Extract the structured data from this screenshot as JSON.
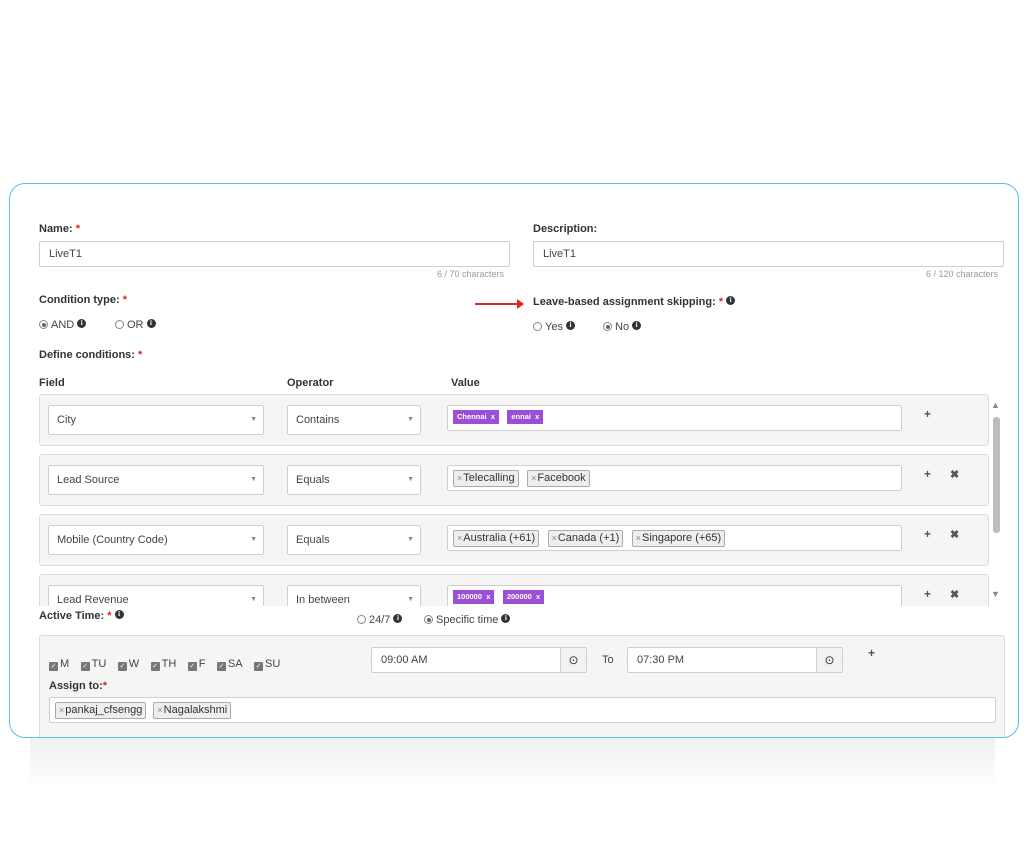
{
  "name": {
    "label": "Name:",
    "required": "*",
    "value": "LiveT1",
    "counter": "6 / 70 characters"
  },
  "description": {
    "label": "Description:",
    "value": "LiveT1",
    "counter": "6 / 120 characters"
  },
  "condition_type": {
    "label": "Condition type:",
    "required": "*",
    "options": [
      "AND",
      "OR"
    ],
    "selected": "AND"
  },
  "leave_skipping": {
    "label": "Leave-based assignment skipping:",
    "required": "*",
    "options": [
      "Yes",
      "No"
    ],
    "selected": "No"
  },
  "define_conditions": {
    "label": "Define conditions:",
    "required": "*"
  },
  "columns": {
    "field": "Field",
    "operator": "Operator",
    "value": "Value"
  },
  "conditions": [
    {
      "field": "City",
      "operator": "Contains",
      "tag_style": "purple",
      "values": [
        "Chennai",
        "ennai"
      ]
    },
    {
      "field": "Lead Source",
      "operator": "Equals",
      "tag_style": "grey",
      "values": [
        "Telecalling",
        "Facebook"
      ]
    },
    {
      "field": "Mobile (Country Code)",
      "operator": "Equals",
      "tag_style": "grey",
      "values": [
        "Australia (+61)",
        "Canada (+1)",
        "Singapore (+65)"
      ]
    },
    {
      "field": "Lead Revenue",
      "operator": "In between",
      "tag_style": "purple",
      "values": [
        "100000",
        "200000"
      ]
    }
  ],
  "active_time": {
    "label": "Active Time:",
    "required": "*",
    "options": [
      "24/7",
      "Specific time"
    ],
    "selected": "Specific time",
    "days": [
      "M",
      "TU",
      "W",
      "TH",
      "F",
      "SA",
      "SU"
    ],
    "from": "09:00 AM",
    "to_label": "To",
    "to": "07:30 PM"
  },
  "assign_to": {
    "label": "Assign to:",
    "required": "*",
    "users": [
      "pankaj_cfsengg",
      "Nagalakshmi"
    ]
  },
  "icons": {
    "info": "info-icon",
    "add": "plus-icon",
    "remove": "close-icon",
    "clock": "clock-icon",
    "tag_remove": "x-icon"
  },
  "colors": {
    "border": "#5bc0e6",
    "tag_purple": "#9b4fd6",
    "required": "#e02424",
    "annotation_arrow": "#e02424"
  }
}
